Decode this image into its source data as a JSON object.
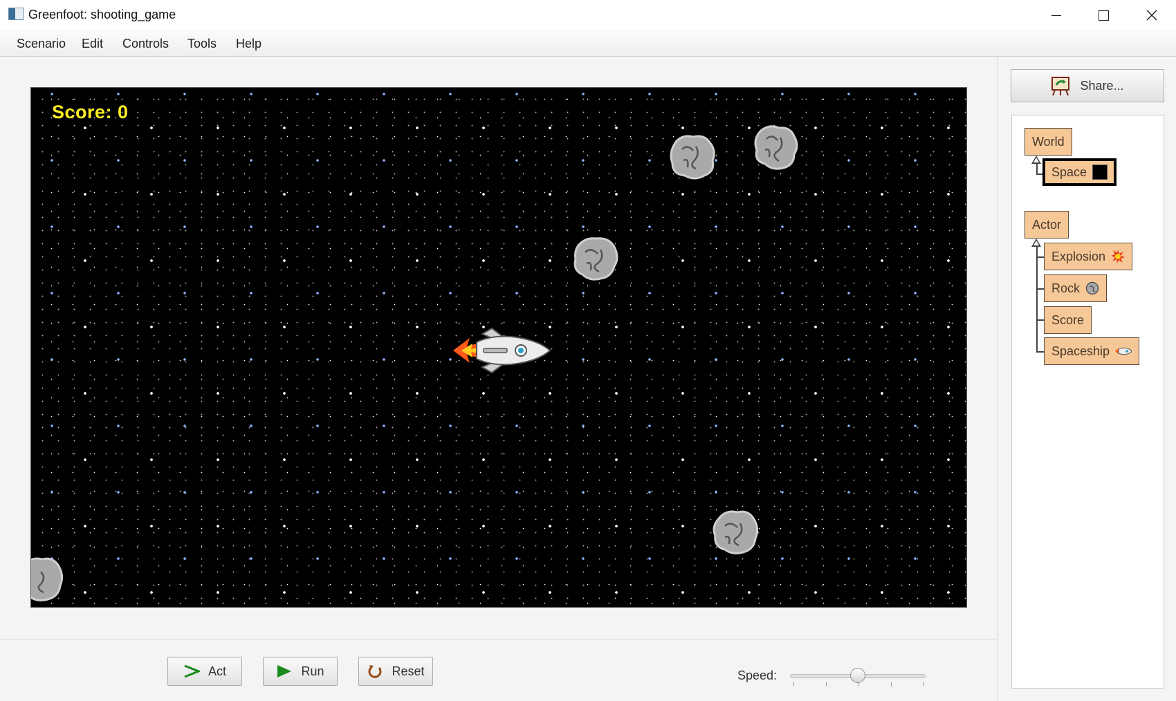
{
  "window": {
    "title": "Greenfoot: shooting_game"
  },
  "menu": {
    "items": [
      "Scenario",
      "Edit",
      "Controls",
      "Tools",
      "Help"
    ]
  },
  "world": {
    "score_text": "Score: 0"
  },
  "controls": {
    "act_label": "Act",
    "run_label": "Run",
    "reset_label": "Reset",
    "speed_label": "Speed:",
    "speed_fraction": 0.5
  },
  "share": {
    "label": "Share..."
  },
  "class_tree": {
    "world_root": "World",
    "world_children": [
      "Space"
    ],
    "actor_root": "Actor",
    "actor_children": [
      "Explosion",
      "Rock",
      "Score",
      "Spaceship"
    ],
    "selected": "Space"
  },
  "colors": {
    "class_fill": "#f6c897",
    "score_text": "#ffee22",
    "world_bg": "#000000"
  }
}
